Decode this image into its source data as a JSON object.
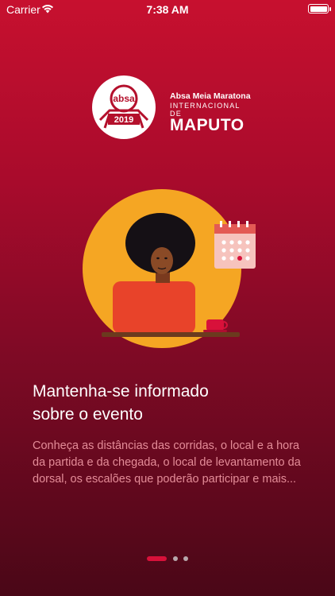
{
  "status_bar": {
    "carrier": "Carrier",
    "time": "7:38 AM"
  },
  "logo": {
    "badge_text": "absa",
    "badge_year": "2019",
    "line1": "Absa Meia Maratona",
    "line2": "INTERNACIONAL DE",
    "line3": "MAPUTO"
  },
  "onboarding": {
    "title_line1": "Mantenha-se informado",
    "title_line2": "sobre o evento",
    "description": "Conheça as distâncias das corridas, o  local e a hora da partida e da chegada, o local de levantamento da dorsal, os escalões que poderão participar e mais...",
    "page_index": 1,
    "page_count": 3
  },
  "colors": {
    "bg_top": "#c7102f",
    "bg_bottom": "#4a0717",
    "accent": "#d8113a",
    "description_text": "#e48c98",
    "sun": "#f5a623",
    "sweater": "#e8432a"
  }
}
